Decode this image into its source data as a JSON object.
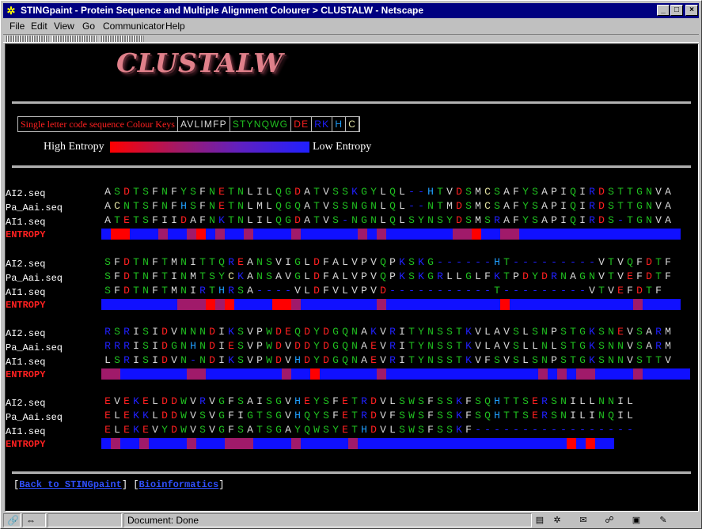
{
  "window": {
    "title": "STINGpaint - Protein Sequence and Multiple Alignment Colourer > CLUSTALW - Netscape"
  },
  "menu": [
    "File",
    "Edit",
    "View",
    "Go",
    "Communicator",
    "Help"
  ],
  "page": {
    "logo": "CLUSTALW",
    "colour_keys": {
      "label": "Single letter code sequence Colour Keys",
      "groups": [
        {
          "text": "AVLIMFP",
          "color": "#d8d8d8"
        },
        {
          "text": "STYNQWG",
          "color": "#20c020"
        },
        {
          "text": "DE",
          "color": "#ff2020"
        },
        {
          "text": "RK",
          "color": "#2020ff"
        },
        {
          "text": "H",
          "color": "#20a0ff"
        },
        {
          "text": "C",
          "color": "#e0e0a0"
        }
      ]
    },
    "entropy_legend": {
      "high": "High Entropy",
      "low": "Low Entropy"
    },
    "blocks": [
      {
        "rows": [
          {
            "name": "AI2.seq",
            "seq": "ASDTSFNFYSFNETNLILQGDATVSSKGYLQL--HTVDSMCSAFYSAPIQIRDSTTGNVA"
          },
          {
            "name": "Pa_Aai.seq",
            "seq": "ACNTSFNFHSFNETNLMLQGQATVSSNGNLQL--NTMDSMCSAFYSAPIQIRDSTTGNVA"
          },
          {
            "name": "AI1.seq",
            "seq": "ATETSFIIDAFNKTNLILQGDATVS-NGNLQLSYNSYDSMSRAFYSAPIQIRDS-TGNVA"
          }
        ],
        "entropy_label": "ENTROPY",
        "entropy": "bRRbbbMbbMRbMbbMbbbbMbbbbbbMbMbbbbbbbMMRbbMMbbbbbbbbbbbbbbbbb"
      },
      {
        "rows": [
          {
            "name": "AI2.seq",
            "seq": "SFDTNFTMNITTQREANSVIGLDFALVPVQPKSKG------HT---------VTVQFDTF"
          },
          {
            "name": "Pa_Aai.seq",
            "seq": "SFDTNFTINMTSYCKANSAVGLDFALVPVQPKSKGRLLGLFKTPDYDRNAGNVTVEFDTF"
          },
          {
            "name": "AI1.seq",
            "seq": "SFDTNFTMNIRTHRSA----VLDFVLVPVD-----------T---------VTVEFDTF"
          }
        ],
        "entropy_label": "ENTROPY",
        "entropy": "bbbbbbbbMMMRMRbbbbRRMbbbbbbbbMbbbbbbbbbbbbRbbbbbbbbbbbbbMbbbb"
      },
      {
        "rows": [
          {
            "name": "AI2.seq",
            "seq": "RSRISIDVNNNDIKSVPWDEQDYDGQNAKVRITYNSSTKVLAVSLSNPSTGKSNEVSARM"
          },
          {
            "name": "Pa_Aai.seq",
            "seq": "RRRISIDGNHNDIESVPWDVDDYDGQNAEVRITYNSSTKVLAVSLLNLSTGKSNNVSARM"
          },
          {
            "name": "AI1.seq",
            "seq": "LSRISIDVN-NDIKSVPWDVHDYDGQNAEVRITYNSSTKVFSVSLSNPSTGKSNNVSTTV"
          }
        ],
        "entropy_label": "ENTROPY",
        "entropy": "MMbbbbbbbMMbbbbbbbbMbbRbbbbbbMbbbbbbbbbbbbbbbbMbMbMMbbbbMbbbbb"
      },
      {
        "rows": [
          {
            "name": "AI2.seq",
            "seq": "EVEKELDDWVRVGFSAISGVHEYSFETRDVLSWSFSSKFSQHTTSERSNILLNNIL"
          },
          {
            "name": "Pa_Aai.seq",
            "seq": "ELEKKLDDWVSVGFIGTSGVHQYSFETRDVFSWSFSSKFSQHTTSERSNILINQIL"
          },
          {
            "name": "AI1.seq",
            "seq": "ELEKEVYDWVSVGFSATSGAYQWSYETHDVLSWSFSSKF-----------------"
          }
        ],
        "entropy_label": "ENTROPY",
        "entropy": "bMbbMbbbbMbbbMMMbbbbMbbbbbMbbbbbbbbbbbbbbbbbbbbbbRbRbb"
      }
    ],
    "links": {
      "back": "Back to STINGpaint",
      "bio": "Bioinformatics"
    }
  },
  "status": {
    "text": "Document: Done"
  },
  "colors": {
    "hydrophobic": "#d8d8d8",
    "polar": "#20c020",
    "acidic": "#ff2020",
    "basic": "#2020ff",
    "his": "#20a0ff",
    "cys": "#e0e0a0",
    "gap": "#2020ff",
    "ent_high": "#ff0000",
    "ent_mid": "#a01a6a",
    "ent_low": "#1010ff"
  }
}
